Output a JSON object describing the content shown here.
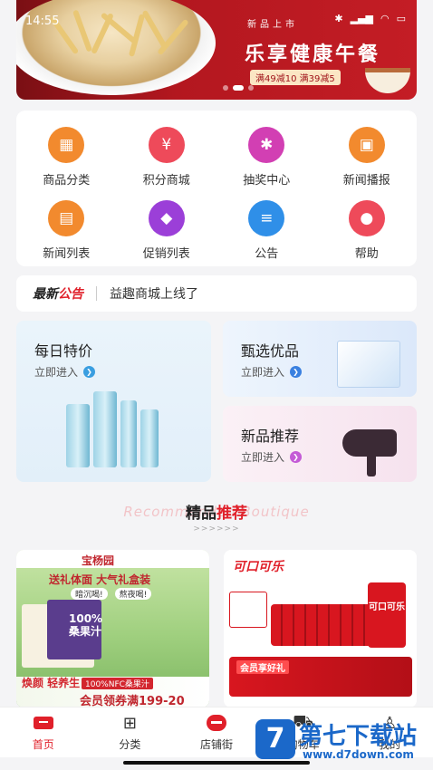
{
  "status_bar": {
    "time": "14:55"
  },
  "banner": {
    "subtitle": "新品上市",
    "title": "乐享健康午餐",
    "tag": "满49减10 满39减5"
  },
  "grid": {
    "items": [
      {
        "label": "商品分类",
        "icon": "category-icon",
        "color": "#f28a2e",
        "glyph": "▦"
      },
      {
        "label": "积分商城",
        "icon": "points-mall-icon",
        "color": "#ee4a5a",
        "glyph": "¥"
      },
      {
        "label": "抽奖中心",
        "icon": "lottery-icon",
        "color": "#d23fb3",
        "glyph": "✱"
      },
      {
        "label": "新闻播报",
        "icon": "radio-icon",
        "color": "#f28a2e",
        "glyph": "▣"
      },
      {
        "label": "新闻列表",
        "icon": "news-list-icon",
        "color": "#f28a2e",
        "glyph": "▤"
      },
      {
        "label": "促销列表",
        "icon": "sale-tag-icon",
        "color": "#9b3fd8",
        "glyph": "◆"
      },
      {
        "label": "公告",
        "icon": "notice-icon",
        "color": "#2f8fe8",
        "glyph": "≡"
      },
      {
        "label": "帮助",
        "icon": "help-icon",
        "color": "#ee4a5a",
        "glyph": "●"
      }
    ]
  },
  "notice": {
    "logo_left": "最新",
    "logo_right": "公告",
    "text": "益趣商城上线了"
  },
  "promo": {
    "daily": {
      "title": "每日特价",
      "action": "立即进入"
    },
    "selected": {
      "title": "甄选优品",
      "action": "立即进入"
    },
    "new": {
      "title": "新品推荐",
      "action": "立即进入"
    }
  },
  "recommend": {
    "bg_text": "Recommended Boutique",
    "title_left": "精品",
    "title_right": "推荐",
    "deco": ">>>>>>"
  },
  "products": {
    "left": {
      "brand": "宝杨园",
      "line": "送礼体面 大气礼盒装",
      "pill1": "暗沉喝!",
      "pill2": "熬夜喝!",
      "box_text": "100% 桑果汁",
      "nfc": "100%NFC桑果汁",
      "foot_left": "焕颜 轻养生",
      "foot_right": "会员领券满199-20"
    },
    "right": {
      "logo": "可口可乐",
      "can_text": "可口可乐",
      "bar_text": "会员享好礼"
    }
  },
  "tabbar": {
    "tabs": [
      {
        "label": "首页",
        "active": true
      },
      {
        "label": "分类",
        "active": false
      },
      {
        "label": "店铺街",
        "active": false
      },
      {
        "label": "购物车",
        "active": false
      },
      {
        "label": "我的",
        "active": false
      }
    ]
  },
  "watermark": {
    "logo": "7",
    "text": "第七下载站",
    "url": "www.d7down.com"
  }
}
